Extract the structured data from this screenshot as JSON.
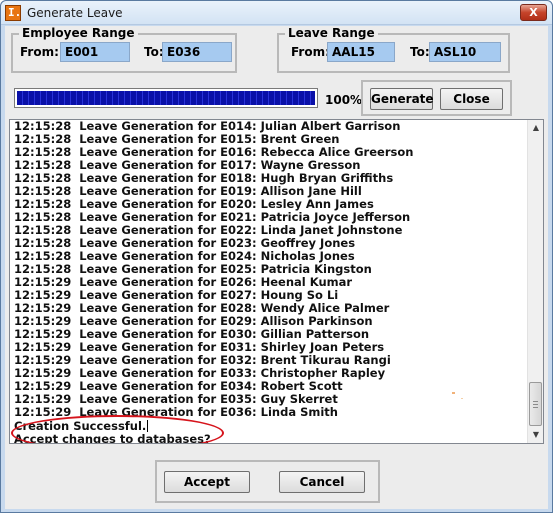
{
  "window": {
    "title": "Generate Leave",
    "app_icon_glyph": "I.",
    "close_glyph": "X"
  },
  "employee_range": {
    "label": "Employee Range",
    "from_label": "From:",
    "from_value": "E001",
    "to_label": "To:",
    "to_value": "E036"
  },
  "leave_range": {
    "label": "Leave Range",
    "from_label": "From:",
    "from_value": "AAL15",
    "to_label": "To:",
    "to_value": "ASL10"
  },
  "progress": {
    "percent_text": "100%",
    "fill_fraction": 1.0
  },
  "actions": {
    "generate_label": "Generate",
    "close_label": "Close"
  },
  "log": {
    "lines": [
      "12:15:28  Leave Generation for E014: Julian Albert Garrison",
      "12:15:28  Leave Generation for E015: Brent Green",
      "12:15:28  Leave Generation for E016: Rebecca Alice Greerson",
      "12:15:28  Leave Generation for E017: Wayne Gresson",
      "12:15:28  Leave Generation for E018: Hugh Bryan Griffiths",
      "12:15:28  Leave Generation for E019: Allison Jane Hill",
      "12:15:28  Leave Generation for E020: Lesley Ann James",
      "12:15:28  Leave Generation for E021: Patricia Joyce Jefferson",
      "12:15:28  Leave Generation for E022: Linda Janet Johnstone",
      "12:15:28  Leave Generation for E023: Geoffrey Jones",
      "12:15:28  Leave Generation for E024: Nicholas Jones",
      "12:15:28  Leave Generation for E025: Patricia Kingston",
      "12:15:29  Leave Generation for E026: Heenal Kumar",
      "12:15:29  Leave Generation for E027: Houng So Li",
      "12:15:29  Leave Generation for E028: Wendy Alice Palmer",
      "12:15:29  Leave Generation for E029: Allison Parkinson",
      "12:15:29  Leave Generation for E030: Gillian Patterson",
      "12:15:29  Leave Generation for E031: Shirley Joan Peters",
      "12:15:29  Leave Generation for E032: Brent Tikurau Rangi",
      "12:15:29  Leave Generation for E033: Christopher Rapley",
      "12:15:29  Leave Generation for E034: Robert Scott",
      "12:15:29  Leave Generation for E035: Guy Skerret",
      "12:15:29  Leave Generation for E036: Linda Smith"
    ],
    "status_line_1": "Creation Successful.",
    "status_line_2": "Accept changes to databases?"
  },
  "scrollbar": {
    "up_glyph": "▲",
    "down_glyph": "▼"
  },
  "confirm": {
    "accept_label": "Accept",
    "cancel_label": "Cancel"
  },
  "colors": {
    "field_bg": "#a6caf0",
    "progress_fill": "#0a10a8",
    "highlight": "#d6141c"
  }
}
